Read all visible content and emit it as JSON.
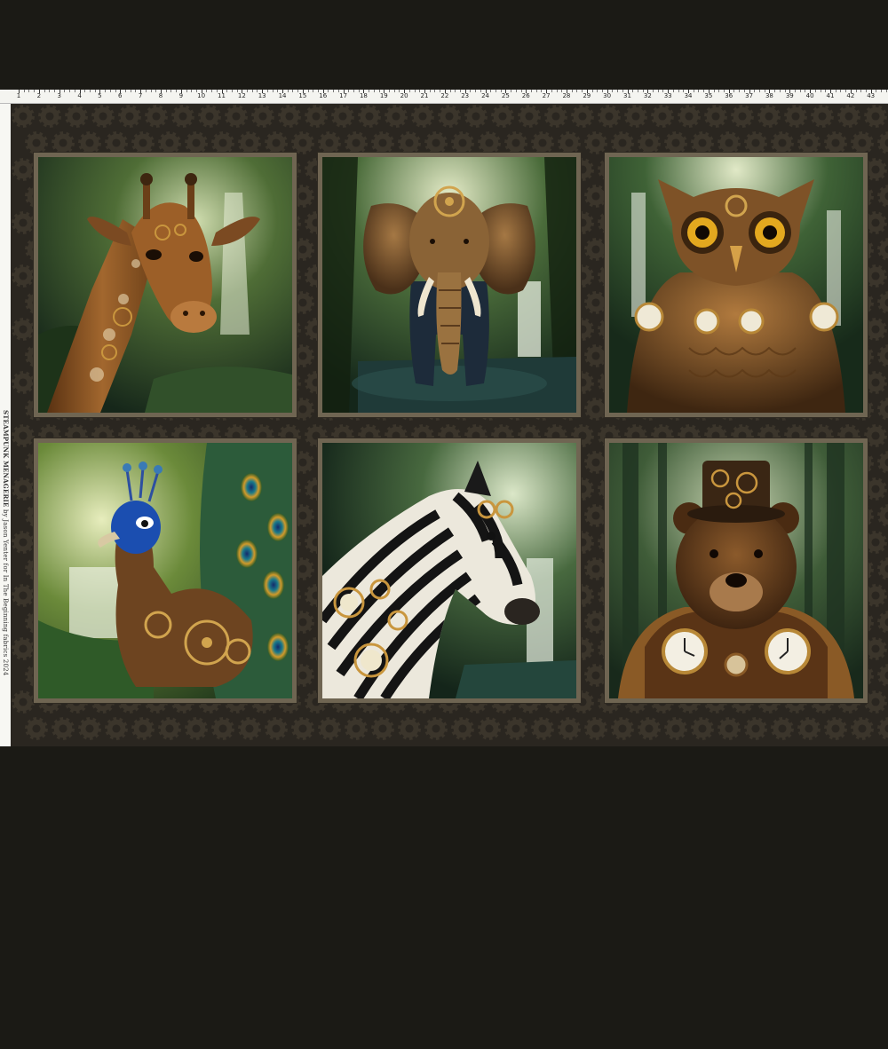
{
  "ruler": {
    "numbers": [
      "1",
      "2",
      "3",
      "4",
      "5",
      "6",
      "7",
      "8",
      "9",
      "10",
      "11",
      "12",
      "13",
      "14",
      "15",
      "16",
      "17",
      "18",
      "19",
      "20",
      "21",
      "22",
      "23",
      "24",
      "25",
      "26",
      "27",
      "28",
      "29",
      "30",
      "31",
      "32",
      "33",
      "34",
      "35",
      "36",
      "37",
      "38",
      "39",
      "40",
      "41",
      "42",
      "43"
    ]
  },
  "selvage": {
    "title": "STEAMPUNK MENAGERIE",
    "credit": "by Jason Yenter for In The Beginning fabrics 2024"
  },
  "panels": [
    {
      "subject": "giraffe",
      "colors": {
        "bg": "#1f3a1c",
        "glow": "#c9d6a6",
        "fur": "#8a5526"
      }
    },
    {
      "subject": "elephant",
      "colors": {
        "bg": "#1e3a24",
        "glow": "#dfe6c1",
        "fur": "#6d4a2c"
      }
    },
    {
      "subject": "owl",
      "colors": {
        "bg": "#27442a",
        "glow": "#d8e2b8",
        "fur": "#6a4322"
      }
    },
    {
      "subject": "peacock",
      "colors": {
        "bg": "#264a24",
        "glow": "#e4eab8",
        "fur": "#1d4fa8"
      }
    },
    {
      "subject": "zebra",
      "colors": {
        "bg": "#1f3b27",
        "glow": "#d6e3c3",
        "fur": "#222222"
      }
    },
    {
      "subject": "bear",
      "colors": {
        "bg": "#243d26",
        "glow": "#cfd8b4",
        "fur": "#5a3619"
      }
    }
  ],
  "colors": {
    "page": "#1b1a15",
    "border": "#2a2620",
    "gear": "#3b352b",
    "frame": "#6f6552",
    "brass": "#b8873a"
  }
}
